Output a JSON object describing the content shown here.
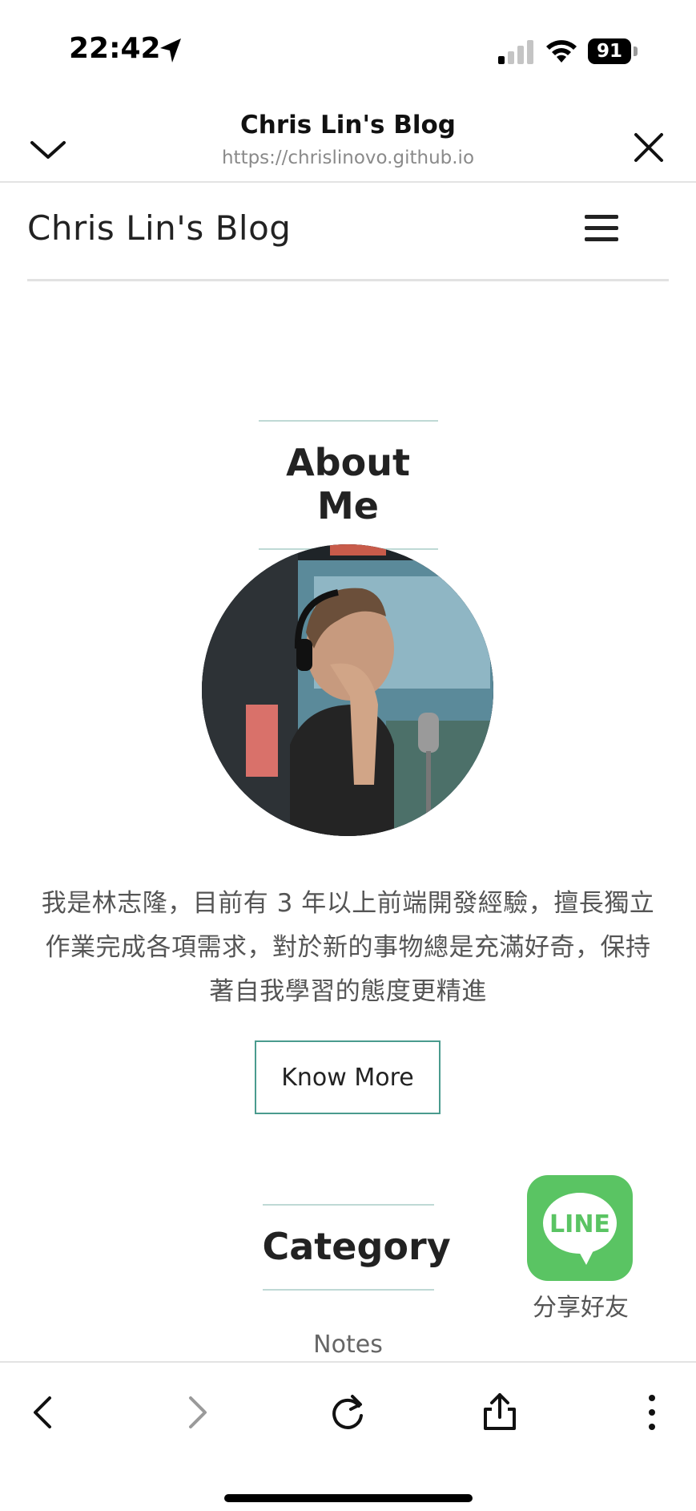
{
  "status_bar": {
    "time": "22:42",
    "battery_level": "91",
    "icons": [
      "location-arrow-icon",
      "signal-icon",
      "wifi-icon",
      "battery-icon"
    ]
  },
  "browser": {
    "title": "Chris Lin's Blog",
    "url": "https://chrislinovo.github.io",
    "icons": [
      "chevron-down-icon",
      "close-icon"
    ]
  },
  "site": {
    "brand": "Chris Lin's Blog",
    "menu_icon": "hamburger-menu-icon"
  },
  "about": {
    "heading": "About Me",
    "text_line1": "我是林志隆，目前有 3 年以上前端開發經驗，擅長獨立",
    "text_line2": "作業完成各項需求，對於新的事物總是充滿好奇，保持",
    "text_line3": "著自我學習的態度更精進",
    "button_label": "Know More"
  },
  "category": {
    "heading": "Category",
    "items": [
      "Notes"
    ]
  },
  "line_share": {
    "logo_text": "LINE",
    "label": "分享好友",
    "brand_color": "#5ac463"
  },
  "toolbar": {
    "icons": [
      "back-icon",
      "forward-icon",
      "reload-icon",
      "share-icon",
      "more-options-icon"
    ]
  },
  "colors": {
    "accent": "#4a9b8e",
    "heading_rule": "#bfd9d5"
  }
}
